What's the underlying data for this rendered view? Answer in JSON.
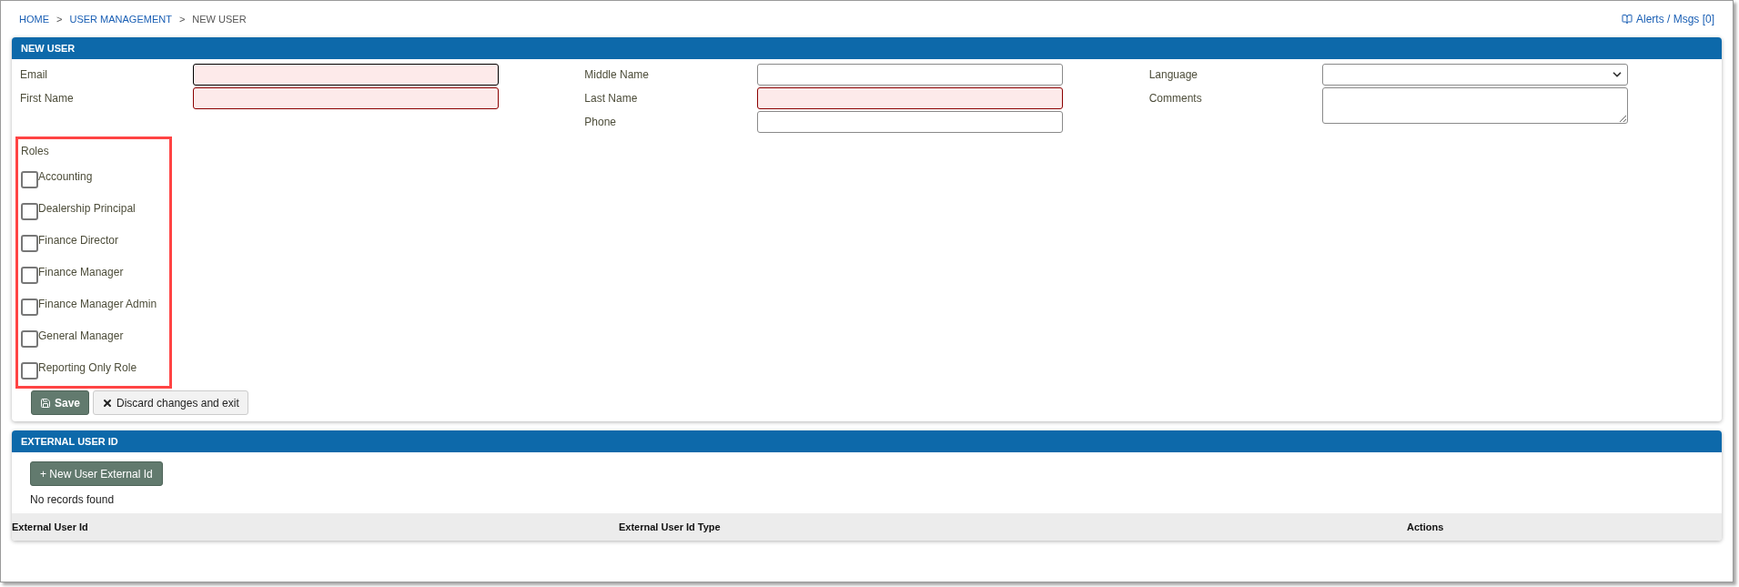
{
  "breadcrumb": [
    {
      "label": "HOME",
      "link": true
    },
    {
      "label": "USER MANAGEMENT",
      "link": true
    },
    {
      "label": "NEW USER",
      "link": false
    }
  ],
  "breadcrumb_separator": ">",
  "alerts": "Alerts / Msgs [0]",
  "new_user": {
    "title": "NEW USER",
    "columns": [
      [
        {
          "label": "Email",
          "kind": "text",
          "invalid": true,
          "focused": true
        },
        {
          "label": "First Name",
          "kind": "text",
          "invalid": true,
          "focused": false
        }
      ],
      [
        {
          "label": "Middle Name",
          "kind": "text",
          "invalid": false,
          "focused": false
        },
        {
          "label": "Last Name",
          "kind": "text",
          "invalid": true,
          "focused": false
        },
        {
          "label": "Phone",
          "kind": "text",
          "invalid": false,
          "focused": false
        }
      ],
      [
        {
          "label": "Language",
          "kind": "select",
          "invalid": false,
          "focused": false
        },
        {
          "label": "Comments",
          "kind": "textarea",
          "invalid": false,
          "focused": false
        }
      ]
    ],
    "roles_label": "Roles",
    "roles": [
      {
        "label": "Accounting",
        "checked": false
      },
      {
        "label": "Dealership Principal",
        "checked": false
      },
      {
        "label": "Finance Director",
        "checked": false
      },
      {
        "label": "Finance Manager",
        "checked": false
      },
      {
        "label": "Finance Manager Admin",
        "checked": false
      },
      {
        "label": "General Manager",
        "checked": false
      },
      {
        "label": "Reporting Only Role",
        "checked": false
      }
    ],
    "save": "Save",
    "discard": "Discard changes and exit"
  },
  "external": {
    "title": "EXTERNAL USER ID",
    "add_button": "+ New User External Id",
    "empty": "No records found",
    "table": {
      "columns": [
        "External User Id",
        "External User Id Type",
        "Actions"
      ]
    }
  }
}
